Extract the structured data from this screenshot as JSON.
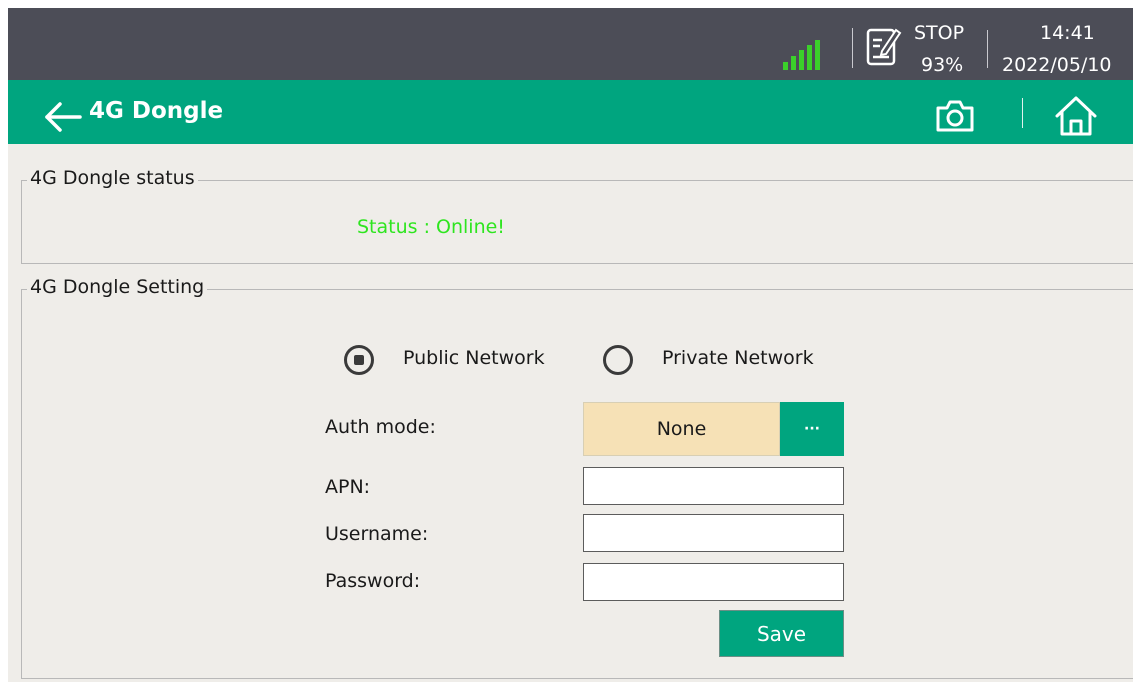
{
  "status_bar": {
    "mode": "STOP",
    "battery": "93%",
    "time": "14:41",
    "date": "2022/05/10",
    "signal_icon": "signal-bars-icon",
    "task_icon": "document-edit-icon"
  },
  "title_bar": {
    "title": "4G Dongle",
    "back_icon": "arrow-left-icon",
    "camera_icon": "camera-icon",
    "home_icon": "home-icon"
  },
  "status_group": {
    "legend": "4G Dongle status",
    "status_text": "Status : Online!"
  },
  "setting_group": {
    "legend": "4G Dongle  Setting",
    "network_options": [
      "Public Network",
      "Private Network"
    ],
    "selected_network": "Public Network",
    "auth_label": "Auth mode:",
    "auth_value": "None",
    "auth_more_label": "···",
    "apn_label": "APN:",
    "apn_value": "",
    "username_label": "Username:",
    "username_value": "",
    "password_label": "Password:",
    "password_value": "",
    "save_label": "Save"
  },
  "colors": {
    "accent": "#00a57f",
    "status_bar_bg": "#4c4d57",
    "online": "#2ee51f",
    "auth_bg": "#f6e1b6",
    "panel_bg": "#efede9"
  }
}
